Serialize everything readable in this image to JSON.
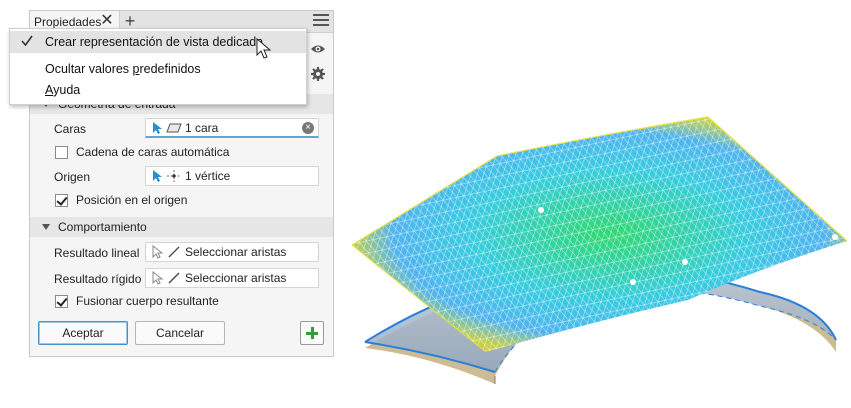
{
  "panel": {
    "tab_label": "Propiedades",
    "tab_close_glyph": "✕",
    "tab_add_glyph": "+",
    "sections": {
      "geometry_title": "Geometría de entrada",
      "behavior_title": "Comportamiento"
    },
    "rows": {
      "faces_label": "Caras",
      "faces_value": "1 cara",
      "chain_label": "Cadena de caras automática",
      "origin_label": "Origen",
      "origin_value": "1 vértice",
      "position_label": "Posición en el origen",
      "linear_label": "Resultado lineal",
      "linear_value": "Seleccionar aristas",
      "rigid_label": "Resultado rígido",
      "rigid_value": "Seleccionar aristas",
      "merge_label": "Fusionar cuerpo resultante"
    },
    "checkboxes": {
      "chain_checked": false,
      "position_checked": true,
      "merge_checked": true
    },
    "buttons": {
      "ok": "Aceptar",
      "cancel": "Cancelar"
    }
  },
  "menu": {
    "items": [
      {
        "label": "Crear representación de vista dedicada",
        "checked": true,
        "highlighted": true
      },
      {
        "label_pre": "Ocultar valores ",
        "label_u": "p",
        "label_post": "redefinidos",
        "checked": false
      },
      {
        "label_u": "A",
        "label_post": "yuda",
        "checked": false
      }
    ]
  },
  "icons": {
    "visibility": "eye-icon",
    "settings": "gear-icon",
    "menu": "hamburger-icon"
  },
  "colors": {
    "accent": "#4a90c2",
    "selector_underline": "#5ba7d6",
    "add_green": "#2e9d3c",
    "mesh_line": "#ffffff",
    "edge_blue": "#2b7fd8"
  }
}
